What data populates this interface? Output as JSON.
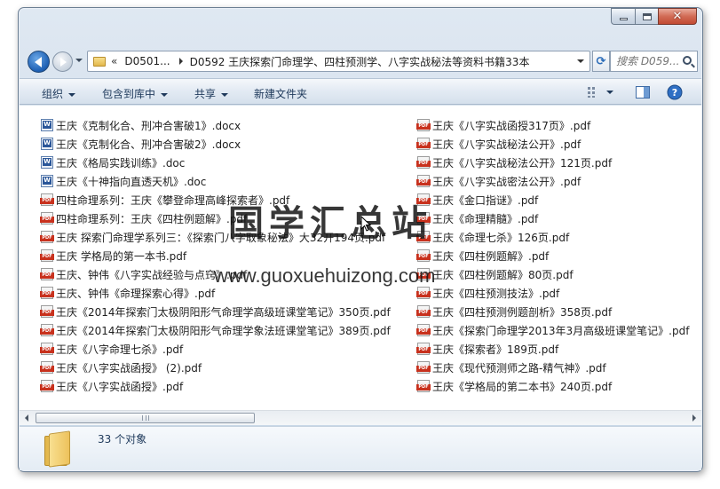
{
  "address": {
    "crumbs": [
      "D0501...",
      "D0592 王庆探索门命理学、四柱预测学、八字实战秘法等资料书籍33本"
    ],
    "chevron": "«"
  },
  "search": {
    "placeholder": "搜索 D059..."
  },
  "toolbar": {
    "organize": "组织",
    "include_in_library": "包含到库中",
    "share": "共享",
    "new_folder": "新建文件夹"
  },
  "files": {
    "left": [
      {
        "name": "王庆《克制化合、刑冲合害破1》.docx",
        "type": "doc"
      },
      {
        "name": "王庆《克制化合、刑冲合害破2》.docx",
        "type": "doc"
      },
      {
        "name": "王庆《格局实践训练》.doc",
        "type": "doc"
      },
      {
        "name": "王庆《十神指向直透天机》.doc",
        "type": "doc"
      },
      {
        "name": "四柱命理系列：王庆《攀登命理高峰探索者》.pdf",
        "type": "pdf"
      },
      {
        "name": "四柱命理系列：王庆《四柱例题解》.pdf",
        "type": "pdf"
      },
      {
        "name": "王庆 探索门命理学系列三：《探索门八字取象秘法》大32开194页.pdf",
        "type": "pdf"
      },
      {
        "name": "王庆 学格局的第一本书.pdf",
        "type": "pdf"
      },
      {
        "name": "王庆、钟伟《八字实战经验与点窍》.pdf",
        "type": "pdf"
      },
      {
        "name": "王庆、钟伟《命理探索心得》.pdf",
        "type": "pdf"
      },
      {
        "name": "王庆《2014年探索门太极阴阳形气命理学高级班课堂笔记》350页.pdf",
        "type": "pdf"
      },
      {
        "name": "王庆《2014年探索门太极阴阳形气命理学象法班课堂笔记》389页.pdf",
        "type": "pdf"
      },
      {
        "name": "王庆《八字命理七杀》.pdf",
        "type": "pdf"
      },
      {
        "name": "王庆《八字实战函授》 (2).pdf",
        "type": "pdf"
      },
      {
        "name": "王庆《八字实战函授》.pdf",
        "type": "pdf"
      }
    ],
    "right": [
      {
        "name": "王庆《八字实战函授317页》.pdf",
        "type": "pdf"
      },
      {
        "name": "王庆《八字实战秘法公开》.pdf",
        "type": "pdf"
      },
      {
        "name": "王庆《八字实战秘法公开》121页.pdf",
        "type": "pdf"
      },
      {
        "name": "王庆《八字实战密法公开》.pdf",
        "type": "pdf"
      },
      {
        "name": "王庆《金口指谜》.pdf",
        "type": "pdf"
      },
      {
        "name": "王庆《命理精髓》.pdf",
        "type": "pdf"
      },
      {
        "name": "王庆《命理七杀》126页.pdf",
        "type": "pdf"
      },
      {
        "name": "王庆《四柱例题解》.pdf",
        "type": "pdf"
      },
      {
        "name": "王庆《四柱例题解》80页.pdf",
        "type": "pdf"
      },
      {
        "name": "王庆《四柱预测技法》.pdf",
        "type": "pdf"
      },
      {
        "name": "王庆《四柱预测例题剖析》358页.pdf",
        "type": "pdf"
      },
      {
        "name": "王庆《探索门命理学2013年3月高级班课堂笔记》.pdf",
        "type": "pdf"
      },
      {
        "name": "王庆《探索者》189页.pdf",
        "type": "pdf"
      },
      {
        "name": "王庆《现代预测师之路-精气神》.pdf",
        "type": "pdf"
      },
      {
        "name": "王庆《学格局的第二本书》240页.pdf",
        "type": "pdf"
      }
    ]
  },
  "watermark": {
    "chinese": "国学汇总站",
    "url": "www.guoxuehuizong.com"
  },
  "scrollbar": {
    "grip": "III"
  },
  "details": {
    "count": "33 个对象"
  },
  "icons": {
    "back": "back-arrow-icon",
    "forward": "forward-arrow-icon",
    "folder": "folder-icon",
    "refresh": "refresh-icon",
    "search": "search-icon",
    "views": "views-icon",
    "preview_pane": "preview-pane-icon",
    "help": "help-icon",
    "pdf": "pdf-file-icon",
    "word": "word-file-icon"
  }
}
